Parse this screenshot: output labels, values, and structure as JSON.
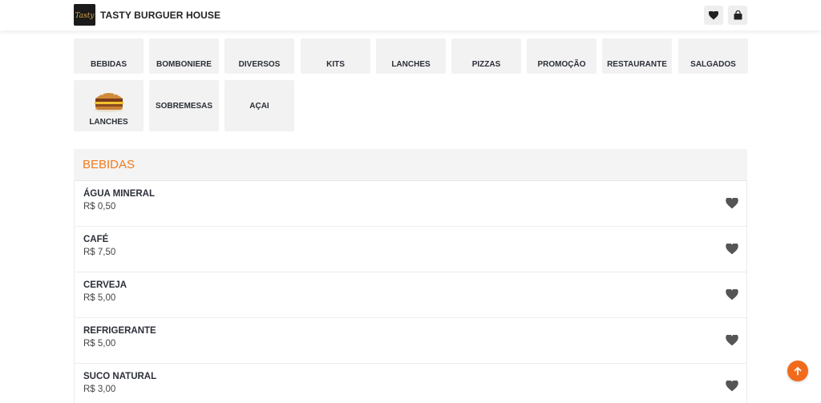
{
  "header": {
    "brand": "TASTY BURGUER HOUSE",
    "logo_text": "Tasty",
    "favorites_icon": "heart-icon",
    "cart_icon": "shopping-bag-icon"
  },
  "categories": [
    {
      "label": "BEBIDAS"
    },
    {
      "label": "BOMBONIERE"
    },
    {
      "label": "DIVERSOS"
    },
    {
      "label": "KITS"
    },
    {
      "label": "LANCHES"
    },
    {
      "label": "PIZZAS"
    },
    {
      "label": "PROMOÇÃO"
    },
    {
      "label": "RESTAURANTE"
    },
    {
      "label": "SALGADOS"
    },
    {
      "label": "LANCHES",
      "image": "burger-image"
    },
    {
      "label": "SOBREMESAS"
    },
    {
      "label": "AÇAI"
    }
  ],
  "section": {
    "title": "BEBIDAS",
    "items": [
      {
        "name": "ÁGUA MINERAL",
        "price": "R$ 0,50"
      },
      {
        "name": "CAFÉ",
        "price": "R$ 7,50"
      },
      {
        "name": "CERVEJA",
        "price": "R$ 5,00"
      },
      {
        "name": "REFRIGERANTE",
        "price": "R$ 5,00"
      },
      {
        "name": "SUCO NATURAL",
        "price": "R$ 3,00"
      }
    ]
  },
  "colors": {
    "accent": "#f07a1d",
    "scroll_button": "#f26a1b",
    "tile_bg": "#f2f2f2"
  },
  "scroll_top_icon": "arrow-up-icon"
}
